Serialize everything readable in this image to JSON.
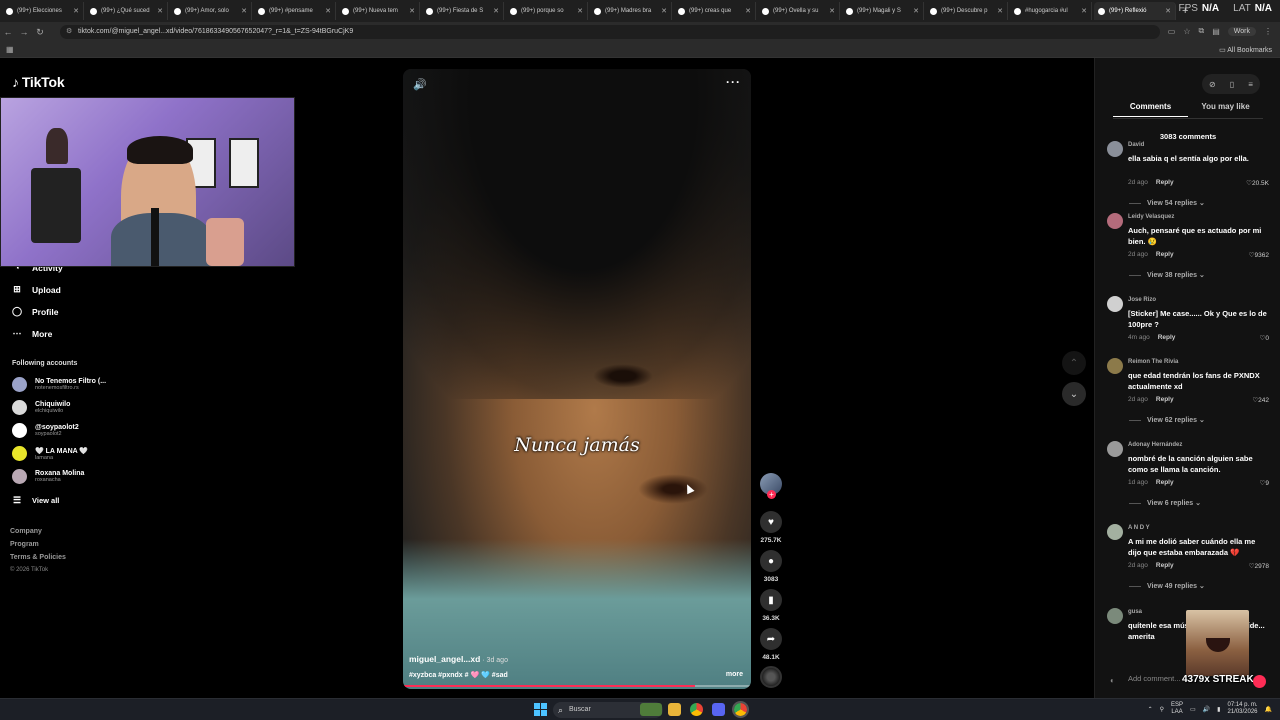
{
  "browser": {
    "tabs": [
      {
        "label": "(99+) Elecciones"
      },
      {
        "label": "(99+) ¿Qué suced"
      },
      {
        "label": "(99+) Amor, solo"
      },
      {
        "label": "(99+) #pensame"
      },
      {
        "label": "(99+) Nueva tem"
      },
      {
        "label": "(99+) Fiesta de S"
      },
      {
        "label": "(99+) porque so"
      },
      {
        "label": "(99+) Madres bra"
      },
      {
        "label": "(99+) creas que"
      },
      {
        "label": "(99+) Ovella y su"
      },
      {
        "label": "(99+) Magali y S"
      },
      {
        "label": "(99+) Descubre p"
      },
      {
        "label": "#hugogarcia #ul"
      },
      {
        "label": "(99+) Reflexió"
      }
    ],
    "url": "tiktok.com/@miguel_angel...xd/video/7618633490567652047?_r=1&_t=ZS-94tBGruCjK9",
    "profile_label": "Work",
    "bookmarks_label": "All Bookmarks",
    "fps_label": "FPS",
    "fps_value": "N/A",
    "lat_label": "LAT",
    "lat_value": "N/A"
  },
  "sidebar": {
    "logo": "TikTok",
    "nav": [
      {
        "label": "Activity",
        "icon": "bell-icon"
      },
      {
        "label": "Upload",
        "icon": "plus-box-icon"
      },
      {
        "label": "Profile",
        "icon": "person-icon"
      },
      {
        "label": "More",
        "icon": "dots-icon"
      }
    ],
    "following_label": "Following accounts",
    "accounts": [
      {
        "name": "No Tenemos Filtro (...",
        "handle": "notenemosfiltro.rs",
        "color": "#9aa2c8"
      },
      {
        "name": "Chiquiwilo",
        "handle": "elchiquiwilo",
        "color": "#d9d9d9"
      },
      {
        "name": "@soypaolot2",
        "handle": "soypaolot2",
        "color": "#ffffff"
      },
      {
        "name": "🤍 LA MANA 🤍",
        "handle": "lamana",
        "color": "#e8e52a"
      },
      {
        "name": "Roxana Molina",
        "handle": "roxanacha",
        "color": "#b9a8b4"
      }
    ],
    "view_all": "View all",
    "footer": [
      "Company",
      "Program",
      "Terms & Policies"
    ],
    "copyright": "© 2026 TikTok"
  },
  "video": {
    "subtitle": "Nunca jamás",
    "author": "miguel_angel...xd",
    "ago": " · 3d ago",
    "tags": "#xyzbca #pxndx # 🩷 🩵 #sad",
    "more": "more",
    "progress": 0.84
  },
  "actions": {
    "likes": "275.7K",
    "comments": "3083",
    "saves": "36.3K",
    "shares": "48.1K"
  },
  "panel": {
    "tabs": [
      "Comments",
      "You may like"
    ],
    "count": "3083 comments",
    "reply_label": "Reply",
    "comments": [
      {
        "user": "David",
        "text": "ella sabia q el sentía algo por ella.",
        "ago": "2d ago",
        "likes": "20.5K",
        "replies": "View 54 replies",
        "color": "#8a8f99"
      },
      {
        "user": "Leidy Velasquez",
        "text": "Auch, pensaré que es actuado por mi bien. 😢",
        "ago": "2d ago",
        "likes": "9362",
        "replies": "View 38 replies",
        "color": "#b46b7b"
      },
      {
        "user": "Jose Rizo",
        "text": "[Sticker] Me case...... Ok y Que es lo de 100pre ?",
        "ago": "4m ago",
        "likes": "0",
        "replies": "",
        "color": "#d0d0d0"
      },
      {
        "user": "Reimon The Rivia",
        "text": "que edad tendrán los fans de PXNDX actualmente xd",
        "ago": "2d ago",
        "likes": "242",
        "replies": "View 62 replies",
        "color": "#8c7a4a"
      },
      {
        "user": "Adonay Hernández",
        "text": "nombré de la canción alguien sabe como se llama la canción.",
        "ago": "1d ago",
        "likes": "9",
        "replies": "View 6 replies",
        "color": "#9a9a9a"
      },
      {
        "user": "A N D Y",
        "text": "A mi me dolió saber cuándo ella me dijo que estaba embarazada 💔",
        "ago": "2d ago",
        "likes": "2978",
        "replies": "View 49 replies",
        "color": "#a3b0a0"
      },
      {
        "user": "gusa",
        "text": "quítenle esa mús... mejor que el víde... amerita",
        "ago": "",
        "likes": "",
        "replies": "",
        "color": "#7b8a7b"
      }
    ],
    "add_placeholder": "Add comment...",
    "streak": "4379x STREAK"
  },
  "taskbar": {
    "search_placeholder": "Buscar",
    "lang": "ESP",
    "lang2": "LAA",
    "time": "07:14 p. m.",
    "date": "21/03/2026"
  }
}
